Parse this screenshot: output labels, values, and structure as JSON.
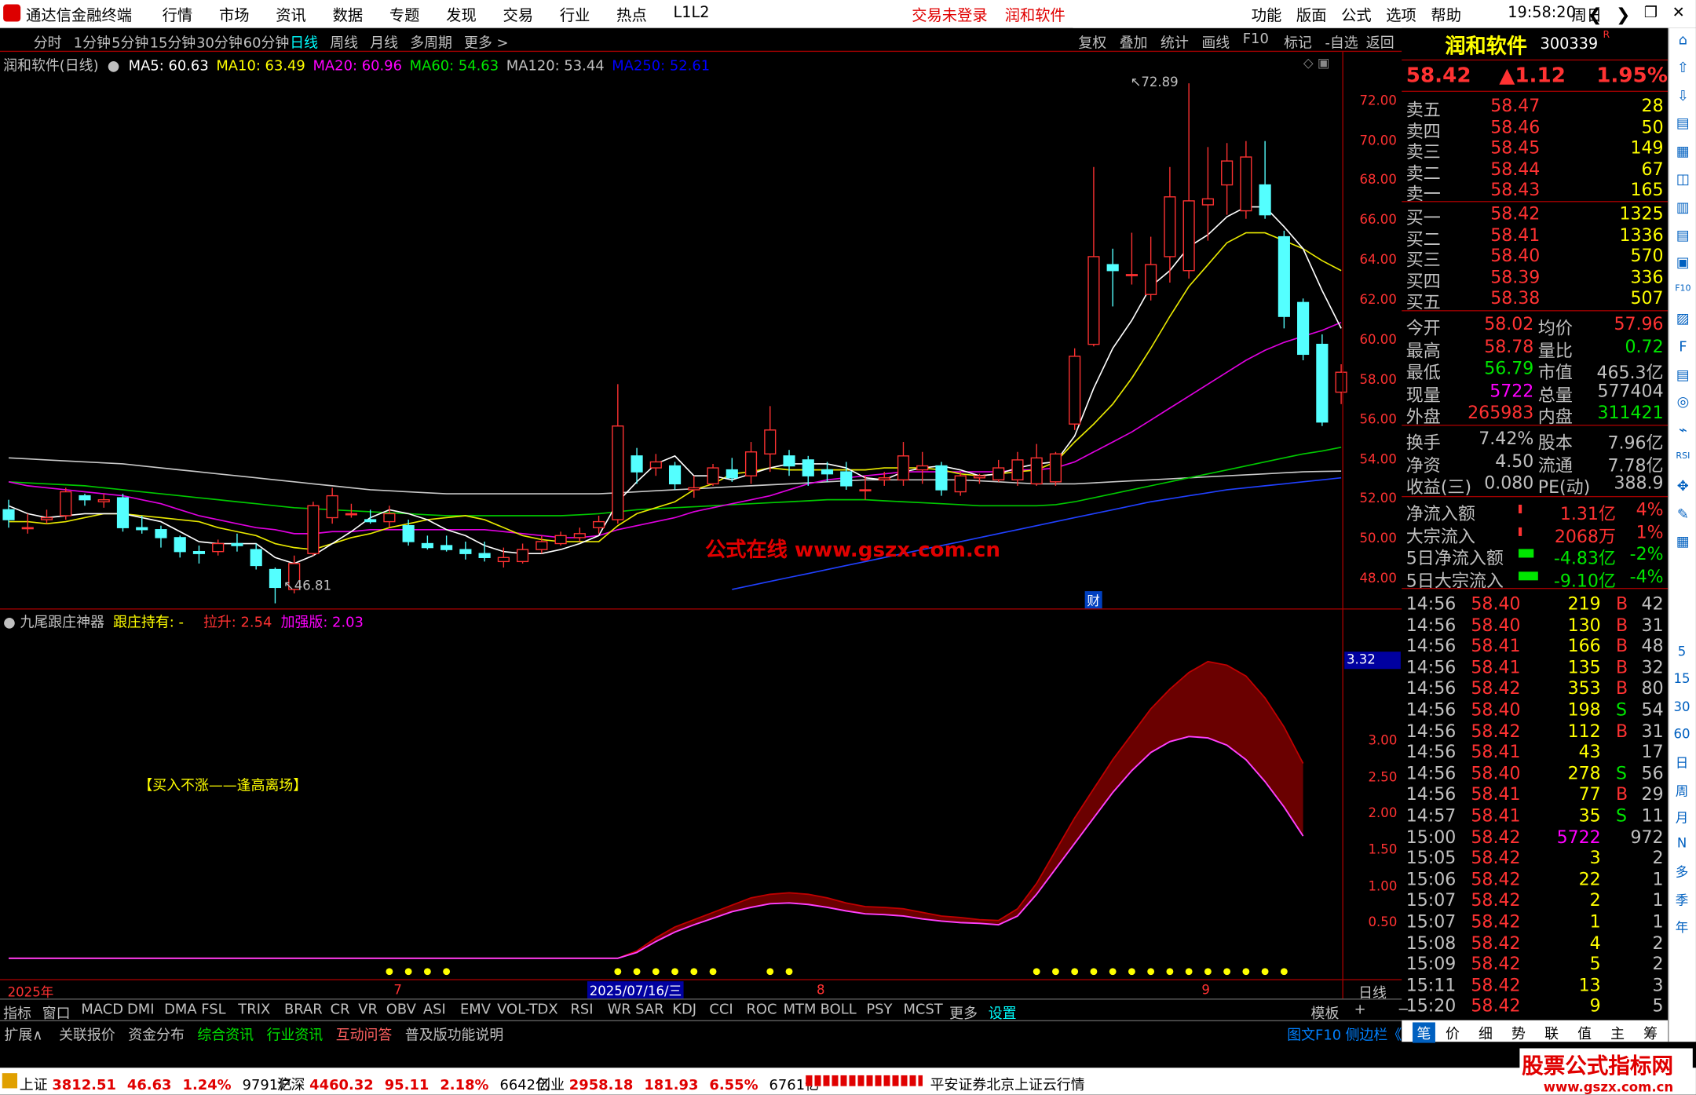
{
  "window": {
    "title": "通达信金融终端",
    "menus": [
      "行情",
      "市场",
      "资讯",
      "数据",
      "专题",
      "发现",
      "交易",
      "行业",
      "热点",
      "L1L2"
    ],
    "login": "交易未登录",
    "product": "润和软件",
    "right_menus": [
      "功能",
      "版面",
      "公式",
      "选项",
      "帮助"
    ],
    "clock": "19:58:20",
    "weekday": "周日"
  },
  "periods": [
    "分时",
    "1分钟",
    "5分钟",
    "15分钟",
    "30分钟",
    "60分钟",
    "日线",
    "周线",
    "月线",
    "多周期",
    "更多 >"
  ],
  "toolbar_right": [
    "复权",
    "叠加",
    "统计",
    "画线",
    "F10",
    "标记",
    "-自选",
    "返回"
  ],
  "main_chart": {
    "label": "润和软件(日线)",
    "ma": [
      {
        "t": "MA5: 60.63",
        "c": "#ffffff"
      },
      {
        "t": "MA10: 63.49",
        "c": "#ffff00"
      },
      {
        "t": "MA20: 60.96",
        "c": "#ff00ff"
      },
      {
        "t": "MA60: 54.63",
        "c": "#00e600"
      },
      {
        "t": "MA120: 53.44",
        "c": "#c0c0c0"
      },
      {
        "t": "MA250: 52.61",
        "c": "#0000ff"
      }
    ],
    "yticks": [
      "72.00",
      "70.00",
      "68.00",
      "66.00",
      "64.00",
      "62.00",
      "60.00",
      "58.00",
      "56.00",
      "54.00",
      "52.00",
      "50.00",
      "48.00"
    ],
    "high_mark": "72.89",
    "low_mark": "46.81",
    "watermark": "公式在线 www.gszx.com.cn",
    "cai": "财"
  },
  "chart_data": {
    "type": "candlestick",
    "candles": [
      [
        51.5,
        51,
        52,
        50.6
      ],
      [
        50.6,
        50.6,
        51.3,
        50.3
      ],
      [
        51,
        51.1,
        51.5,
        50.8
      ],
      [
        51.2,
        52.4,
        52.6,
        51
      ],
      [
        52.2,
        52,
        52.3,
        51.7
      ],
      [
        51.9,
        52,
        52.3,
        51.6
      ],
      [
        52.1,
        50.6,
        52.3,
        50.4
      ],
      [
        50.6,
        50.5,
        51.2,
        50.3
      ],
      [
        50.5,
        50.1,
        50.7,
        49.6
      ],
      [
        50.1,
        49.4,
        50.2,
        49.1
      ],
      [
        49.4,
        49.3,
        49.7,
        48.8
      ],
      [
        49.4,
        49.8,
        50,
        49.2
      ],
      [
        49.8,
        49.7,
        50.3,
        49.4
      ],
      [
        49.5,
        48.7,
        49.8,
        48.5
      ],
      [
        48.5,
        47.6,
        48.6,
        46.8
      ],
      [
        47.5,
        48.8,
        49.2,
        47.3
      ],
      [
        49.3,
        51.7,
        51.9,
        49.2
      ],
      [
        51.1,
        52.2,
        52.6,
        50.8
      ],
      [
        51.3,
        51.3,
        51.8,
        51.1
      ],
      [
        51,
        50.9,
        51.5,
        50.8
      ],
      [
        50.9,
        51.3,
        51.7,
        50.6
      ],
      [
        50.7,
        49.9,
        51,
        49.7
      ],
      [
        49.8,
        49.6,
        50.2,
        49.5
      ],
      [
        49.7,
        49.5,
        50.2,
        49.4
      ],
      [
        49.5,
        49.3,
        49.9,
        49
      ],
      [
        49.3,
        49.1,
        49.9,
        48.9
      ],
      [
        48.9,
        49.1,
        49.6,
        48.6
      ],
      [
        48.9,
        49.5,
        49.8,
        48.8
      ],
      [
        49.5,
        49.9,
        50.2,
        49.3
      ],
      [
        49.8,
        50.2,
        50.4,
        49.7
      ],
      [
        50.1,
        50.3,
        50.6,
        49.9
      ],
      [
        50.6,
        50.9,
        51.2,
        50.3
      ],
      [
        51,
        55.7,
        57.8,
        50.8
      ],
      [
        54.2,
        53.4,
        54.6,
        52.8
      ],
      [
        53.6,
        53.9,
        54.3,
        53.2
      ],
      [
        53.7,
        52.8,
        53.9,
        52.5
      ],
      [
        52.5,
        52.6,
        53.2,
        52.1
      ],
      [
        52.8,
        53.6,
        53.8,
        52.7
      ],
      [
        53.5,
        53.1,
        54.1,
        52.9
      ],
      [
        53.2,
        54.4,
        54.9,
        52.8
      ],
      [
        54.3,
        55.5,
        56.7,
        53.4
      ],
      [
        54.2,
        53.7,
        54.5,
        53.2
      ],
      [
        54,
        53.2,
        54.2,
        52.7
      ],
      [
        53.5,
        53.3,
        53.9,
        52.9
      ],
      [
        53.4,
        52.7,
        53.9,
        52.5
      ],
      [
        52.5,
        52.5,
        53.2,
        52
      ],
      [
        53,
        53.1,
        53.4,
        52.7
      ],
      [
        53,
        54.2,
        54.9,
        52.7
      ],
      [
        53.5,
        53.7,
        54.4,
        52.8
      ],
      [
        53.7,
        52.5,
        53.9,
        52.2
      ],
      [
        52.4,
        53.2,
        53.4,
        52.2
      ],
      [
        53.1,
        53.2,
        53.3,
        52.8
      ],
      [
        53,
        53.6,
        54,
        52.9
      ],
      [
        53,
        54,
        54.4,
        52.7
      ],
      [
        52.8,
        54.1,
        54.8,
        52.7
      ],
      [
        52.9,
        54.3,
        54.4,
        52.7
      ],
      [
        55.8,
        59.2,
        59.6,
        55.5
      ],
      [
        59.8,
        64.2,
        68.7,
        59.7
      ],
      [
        63.8,
        63.5,
        64.6,
        61.7
      ],
      [
        63.3,
        63.3,
        65.4,
        62.8
      ],
      [
        62.3,
        63.8,
        65.2,
        62
      ],
      [
        64.2,
        67.2,
        68.7,
        62.9
      ],
      [
        63.5,
        67,
        72.9,
        63.1
      ],
      [
        66.8,
        67.1,
        69.7,
        65
      ],
      [
        67.8,
        69,
        69.9,
        66.3
      ],
      [
        66.5,
        69.2,
        70,
        66.1
      ],
      [
        67.8,
        66.3,
        70,
        66.1
      ],
      [
        65.2,
        61.2,
        65.5,
        60.6
      ],
      [
        61.9,
        59.3,
        62.1,
        59
      ],
      [
        59.8,
        55.9,
        60.3,
        55.7
      ],
      [
        57.4,
        58.4,
        58.8,
        56.8
      ]
    ],
    "ma5": [
      51.7,
      51.3,
      51.1,
      51.2,
      51.3,
      51.3,
      51.3,
      51.1,
      50.9,
      50.4,
      49.9,
      49.8,
      49.8,
      49.8,
      49.1,
      48.8,
      49.2,
      49.8,
      50.4,
      51.1,
      51.5,
      51.3,
      51,
      50.5,
      50.2,
      49.7,
      49.4,
      49.3,
      49.3,
      49.5,
      49.8,
      50.2,
      51.9,
      52.9,
      53.8,
      54.2,
      53.2,
      53.2,
      53,
      53.3,
      53.6,
      53.8,
      53.8,
      53.8,
      53.6,
      53.1,
      53,
      53.4,
      53.6,
      53.7,
      53.5,
      53.2,
      53.3,
      53.6,
      53.8,
      53.9,
      55.2,
      57.6,
      59.6,
      61,
      62.7,
      63.5,
      64.7,
      65.3,
      66.2,
      66.7,
      66.7,
      65.7,
      64.6,
      62.5,
      60.6
    ],
    "ma10": [
      50.9,
      50.9,
      50.8,
      50.9,
      51.1,
      51.3,
      51.3,
      51.2,
      51.1,
      51,
      50.9,
      50.6,
      50.4,
      50.2,
      49.8,
      49.6,
      49.5,
      49.8,
      50.1,
      50.3,
      50.6,
      50.8,
      51,
      51.1,
      51.2,
      51,
      50.6,
      50.2,
      50,
      49.9,
      49.9,
      49.9,
      50.7,
      51.3,
      51.6,
      51.9,
      52.5,
      52.8,
      53.3,
      53.4,
      53.6,
      53.5,
      53.5,
      53.5,
      53.5,
      53.5,
      53.6,
      53.6,
      53.6,
      53.5,
      53.3,
      53.2,
      53.3,
      53.4,
      53.5,
      53.9,
      54.9,
      55.8,
      56.8,
      58.1,
      59.6,
      61.2,
      62.7,
      63.8,
      64.9,
      65.4,
      65.4,
      65,
      64.6,
      64,
      63.5
    ],
    "ma20": [
      52.9,
      52.7,
      52.6,
      52.5,
      52.4,
      52.3,
      52.2,
      52,
      51.8,
      51.5,
      51.2,
      51,
      50.8,
      50.6,
      50.5,
      50.3,
      50.3,
      50.4,
      50.4,
      50.5,
      50.5,
      50.5,
      50.5,
      50.5,
      50.5,
      50.5,
      50.4,
      50.3,
      50.2,
      50.1,
      50.1,
      50.2,
      50.5,
      50.7,
      50.9,
      51.1,
      51.4,
      51.6,
      51.8,
      52,
      52.2,
      52.5,
      52.8,
      53,
      53.1,
      53.2,
      53.3,
      53.4,
      53.4,
      53.4,
      53.4,
      53.4,
      53.4,
      53.5,
      53.5,
      53.6,
      53.9,
      54.4,
      54.9,
      55.4,
      56,
      56.6,
      57.2,
      57.8,
      58.4,
      59,
      59.5,
      59.9,
      60.2,
      60.5,
      60.9
    ],
    "ma60": [
      52.9,
      52.85,
      52.8,
      52.75,
      52.7,
      52.6,
      52.5,
      52.4,
      52.3,
      52.2,
      52.1,
      52,
      51.9,
      51.8,
      51.7,
      51.6,
      51.55,
      51.5,
      51.45,
      51.4,
      51.35,
      51.3,
      51.25,
      51.2,
      51.2,
      51.2,
      51.2,
      51.2,
      51.2,
      51.2,
      51.25,
      51.3,
      51.4,
      51.5,
      51.55,
      51.6,
      51.65,
      51.7,
      51.75,
      51.8,
      51.85,
      51.9,
      51.95,
      52,
      52,
      52,
      51.95,
      51.9,
      51.85,
      51.8,
      51.75,
      51.7,
      51.7,
      51.7,
      51.7,
      51.75,
      51.9,
      52.1,
      52.3,
      52.5,
      52.7,
      52.9,
      53.1,
      53.3,
      53.5,
      53.7,
      53.9,
      54.1,
      54.3,
      54.45,
      54.63
    ],
    "ma120": [
      54.1,
      54.05,
      54,
      53.95,
      53.9,
      53.85,
      53.8,
      53.7,
      53.6,
      53.5,
      53.4,
      53.3,
      53.2,
      53.1,
      53,
      52.9,
      52.8,
      52.7,
      52.6,
      52.5,
      52.45,
      52.4,
      52.35,
      52.3,
      52.3,
      52.3,
      52.3,
      52.3,
      52.3,
      52.3,
      52.3,
      52.3,
      52.35,
      52.4,
      52.45,
      52.5,
      52.55,
      52.6,
      52.65,
      52.7,
      52.75,
      52.8,
      52.85,
      52.9,
      52.95,
      53,
      53,
      53,
      53,
      53,
      53,
      52.95,
      52.9,
      52.85,
      52.8,
      52.8,
      52.8,
      52.85,
      52.9,
      52.95,
      53,
      53.05,
      53.1,
      53.15,
      53.2,
      53.25,
      53.3,
      53.35,
      53.4,
      53.42,
      53.44
    ],
    "ma250": [
      null,
      null,
      null,
      null,
      null,
      null,
      null,
      null,
      null,
      null,
      null,
      null,
      null,
      null,
      null,
      null,
      null,
      null,
      null,
      null,
      null,
      null,
      null,
      null,
      null,
      null,
      null,
      null,
      null,
      null,
      null,
      null,
      null,
      null,
      null,
      null,
      null,
      null,
      47.5,
      47.7,
      47.9,
      48.1,
      48.3,
      48.5,
      48.7,
      48.9,
      49.1,
      49.3,
      49.5,
      49.7,
      49.9,
      50.1,
      50.3,
      50.5,
      50.7,
      50.9,
      51.1,
      51.3,
      51.5,
      51.7,
      51.9,
      52.05,
      52.2,
      52.35,
      52.5,
      52.6,
      52.7,
      52.8,
      52.9,
      53,
      53.1
    ],
    "ind_upper": [
      0.02,
      0.02,
      0.02,
      0.02,
      0.02,
      0.02,
      0.02,
      0.02,
      0.02,
      0.02,
      0.02,
      0.02,
      0.02,
      0.02,
      0.02,
      0.02,
      0.02,
      0.02,
      0.02,
      0.02,
      0.02,
      0.02,
      0.02,
      0.02,
      0.02,
      0.02,
      0.02,
      0.02,
      0.02,
      0.02,
      0.02,
      0.02,
      0.02,
      0.12,
      0.3,
      0.45,
      0.55,
      0.65,
      0.75,
      0.85,
      0.9,
      0.92,
      0.9,
      0.85,
      0.78,
      0.73,
      0.72,
      0.7,
      0.65,
      0.6,
      0.58,
      0.55,
      0.54,
      0.7,
      1.05,
      1.5,
      1.95,
      2.35,
      2.75,
      3.1,
      3.45,
      3.72,
      3.95,
      4.1,
      4.05,
      3.9,
      3.6,
      3.2,
      2.7
    ],
    "ind_lower": [
      0.02,
      0.02,
      0.02,
      0.02,
      0.02,
      0.02,
      0.02,
      0.02,
      0.02,
      0.02,
      0.02,
      0.02,
      0.02,
      0.02,
      0.02,
      0.02,
      0.02,
      0.02,
      0.02,
      0.02,
      0.02,
      0.02,
      0.02,
      0.02,
      0.02,
      0.02,
      0.02,
      0.02,
      0.02,
      0.02,
      0.02,
      0.02,
      0.02,
      0.1,
      0.25,
      0.38,
      0.48,
      0.57,
      0.66,
      0.72,
      0.77,
      0.78,
      0.76,
      0.72,
      0.67,
      0.63,
      0.62,
      0.6,
      0.56,
      0.53,
      0.51,
      0.5,
      0.48,
      0.6,
      0.9,
      1.25,
      1.6,
      1.95,
      2.3,
      2.6,
      2.85,
      3.0,
      3.07,
      3.05,
      2.95,
      2.75,
      2.45,
      2.1,
      1.7
    ],
    "dots": [
      20,
      21,
      22,
      23,
      32,
      33,
      34,
      35,
      36,
      37,
      40,
      41,
      54,
      55,
      56,
      57,
      58,
      59,
      60,
      61,
      62,
      63,
      64,
      65,
      66,
      67
    ]
  },
  "indicator": {
    "name": "九尾跟庄神器",
    "hold": "跟庄持有: -",
    "lift": "拉升: 2.54",
    "boost": "加强版: 2.03",
    "note": "【买入不涨——逢高离场】",
    "yticks": [
      "3.00",
      "2.50",
      "2.00",
      "1.50",
      "1.00",
      "0.50"
    ],
    "current": "3.32"
  },
  "dates": {
    "year": "2025年",
    "m7": "7",
    "sel": "2025/07/16/三",
    "m8": "8",
    "m9": "9",
    "period": "日线"
  },
  "ind_tabs": [
    "指标",
    "窗口",
    "MACD",
    "DMI",
    "DMA",
    "FSL",
    "TRIX",
    "BRAR",
    "CR",
    "VR",
    "OBV",
    "ASI",
    "EMV",
    "VOL-TDX",
    "RSI",
    "WR",
    "SAR",
    "KDJ",
    "CCI",
    "ROC",
    "MTM",
    "BOLL",
    "PSY",
    "MCST",
    "更多",
    "设置"
  ],
  "ind_right": [
    "模板",
    "+",
    "−"
  ],
  "bottom_tabs": [
    "扩展∧",
    "关联报价",
    "资金分布",
    "综合资讯",
    "行业资讯",
    "互动问答",
    "普及版功能说明"
  ],
  "bottom_right": [
    "图文F10",
    "侧边栏《"
  ],
  "side_tabs": [
    "笔",
    "价",
    "细",
    "势",
    "联",
    "值",
    "主",
    "筹"
  ],
  "quote": {
    "name": "润和软件",
    "code": "300339",
    "price": "58.42",
    "change": "▲1.12",
    "pct": "1.95%",
    "asks": [
      [
        "卖五",
        "58.47",
        "28"
      ],
      [
        "卖四",
        "58.46",
        "50"
      ],
      [
        "卖三",
        "58.45",
        "149"
      ],
      [
        "卖二",
        "58.44",
        "67"
      ],
      [
        "卖一",
        "58.43",
        "165"
      ]
    ],
    "bids": [
      [
        "买一",
        "58.42",
        "1325"
      ],
      [
        "买二",
        "58.41",
        "1336"
      ],
      [
        "买三",
        "58.40",
        "570"
      ],
      [
        "买四",
        "58.39",
        "336"
      ],
      [
        "买五",
        "58.38",
        "507"
      ]
    ],
    "stats": [
      [
        "今开",
        "58.02",
        "均价",
        "57.96"
      ],
      [
        "最高",
        "58.78",
        "量比",
        "0.72"
      ],
      [
        "最低",
        "56.79",
        "市值",
        "465.3亿"
      ],
      [
        "现量",
        "5722",
        "总量",
        "577404"
      ],
      [
        "外盘",
        "265983",
        "内盘",
        "311421"
      ]
    ],
    "stats2": [
      [
        "换手",
        "7.42%",
        "股本",
        "7.96亿"
      ],
      [
        "净资",
        "4.50",
        "流通",
        "7.78亿"
      ],
      [
        "收益(三)",
        "0.080",
        "PE(动)",
        "388.9"
      ]
    ],
    "flows": [
      [
        "净流入额",
        "1.31亿",
        "4%"
      ],
      [
        "大宗流入",
        "2068万",
        "1%"
      ],
      [
        "5日净流入额",
        "-4.83亿",
        "-2%"
      ],
      [
        "5日大宗流入",
        "-9.10亿",
        "-4%"
      ]
    ],
    "ticks": [
      [
        "14:56",
        "58.40",
        "219",
        "B",
        "42"
      ],
      [
        "14:56",
        "58.40",
        "130",
        "B",
        "31"
      ],
      [
        "14:56",
        "58.41",
        "166",
        "B",
        "48"
      ],
      [
        "14:56",
        "58.41",
        "135",
        "B",
        "32"
      ],
      [
        "14:56",
        "58.42",
        "353",
        "B",
        "80"
      ],
      [
        "14:56",
        "58.40",
        "198",
        "S",
        "54"
      ],
      [
        "14:56",
        "58.42",
        "112",
        "B",
        "31"
      ],
      [
        "14:56",
        "58.41",
        "43",
        "",
        "17"
      ],
      [
        "14:56",
        "58.40",
        "278",
        "S",
        "56"
      ],
      [
        "14:56",
        "58.41",
        "77",
        "B",
        "29"
      ],
      [
        "14:57",
        "58.41",
        "35",
        "S",
        "11"
      ],
      [
        "15:00",
        "58.42",
        "5722",
        "",
        "972"
      ],
      [
        "15:05",
        "58.42",
        "3",
        "",
        "2"
      ],
      [
        "15:06",
        "58.42",
        "22",
        "",
        "1"
      ],
      [
        "15:07",
        "58.42",
        "2",
        "",
        "1"
      ],
      [
        "15:07",
        "58.42",
        "1",
        "",
        "1"
      ],
      [
        "15:08",
        "58.42",
        "4",
        "",
        "2"
      ],
      [
        "15:09",
        "58.42",
        "5",
        "",
        "2"
      ],
      [
        "15:11",
        "58.42",
        "13",
        "",
        "3"
      ],
      [
        "15:20",
        "58.42",
        "9",
        "",
        "5"
      ]
    ]
  },
  "sidebar_right": [
    "5",
    "15",
    "30",
    "60",
    "日",
    "周",
    "月",
    "N",
    "多",
    "季",
    "年"
  ],
  "status": {
    "sh": "上证",
    "sh_v": "3812.51",
    "sh_c": "46.63",
    "sh_p": "1.24%",
    "sh_a": "9791亿",
    "hs": "沪深",
    "hs_v": "4460.32",
    "hs_c": "95.11",
    "hs_p": "2.18%",
    "hs_a": "6642亿",
    "cy": "创业",
    "cy_v": "2958.18",
    "cy_c": "181.93",
    "cy_p": "6.55%",
    "cy_a": "6761亿",
    "broker": "平安证券北京上证云行情",
    "logo": "股票公式指标网",
    "logo_url": "www.gszx.com.cn"
  }
}
